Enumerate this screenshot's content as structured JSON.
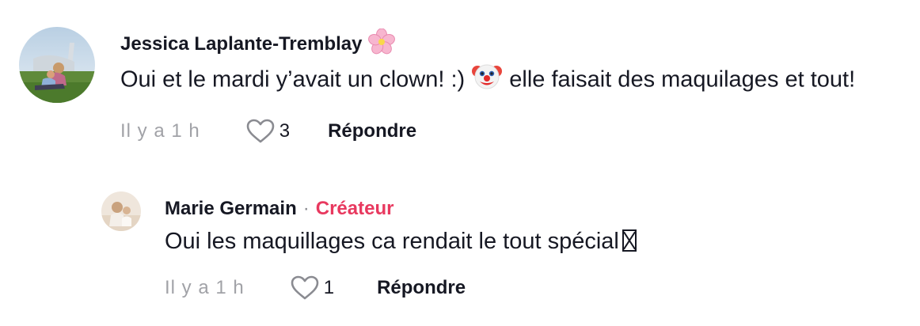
{
  "comments": [
    {
      "author": "Jessica Laplante-Tremblay",
      "author_emoji_icon": "cherry-blossom-icon",
      "text_part1": "Oui et le mardi y’avait un clown! :)",
      "text_emoji_icon": "clown-face-icon",
      "text_part2": "elle faisait des maquilages et tout!",
      "time": "Il y a 1 h",
      "likes": "3",
      "reply_label": "Répondre"
    },
    {
      "author": "Marie Germain",
      "separator": "·",
      "badge": "Créateur",
      "text": "Oui les maquillages ca rendait le tout spécial",
      "text_glyph_icon": "missing-glyph-box-icon",
      "time": "Il y a 1 h",
      "likes": "1",
      "reply_label": "Répondre"
    }
  ],
  "colors": {
    "text": "#161823",
    "muted": "#8a8b91",
    "creator_badge": "#e8395f"
  }
}
